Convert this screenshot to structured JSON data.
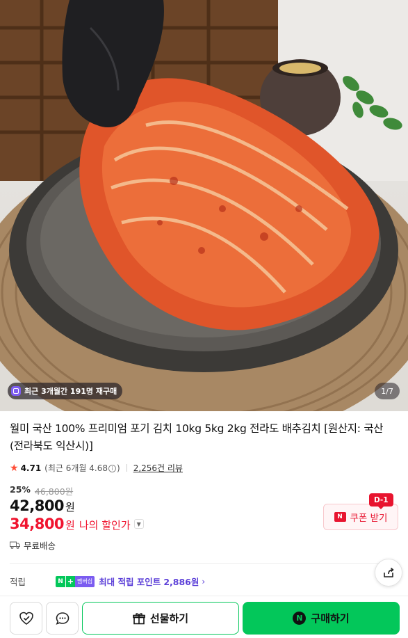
{
  "hero": {
    "rebuy_badge": "최근 3개월간 191명 재구매",
    "page_counter": "1/7"
  },
  "product": {
    "title": "월미 국산 100% 프리미엄 포기 김치 10kg 5kg 2kg 전라도 배추김치 [원산지: 국산(전라북도 익산시)]",
    "rating": "4.71",
    "recent_rating_prefix": "(최근 6개월 4.68",
    "recent_rating_suffix": ")",
    "review_count": "2,256건 리뷰"
  },
  "price": {
    "discount_rate": "25%",
    "original_price": "46,800원",
    "sale_price": "42,800",
    "sale_unit": "원",
    "member_price": "34,800",
    "member_unit": "원",
    "member_label": "나의 할인가"
  },
  "coupon": {
    "dday": "D-1",
    "label": "쿠폰 받기",
    "badge": "N"
  },
  "shipping": {
    "label": "무료배송"
  },
  "points": {
    "label": "적립",
    "npay_n": "N",
    "npay_plus": "+",
    "npay_member": "멤버십",
    "text": "최대 적립 포인트",
    "value": "2,886원"
  },
  "bottom_bar": {
    "gift_label": "선물하기",
    "buy_label": "구매하기",
    "buy_badge": "N"
  },
  "colors": {
    "accent_green": "#03c75a",
    "discount_red": "#f0142f",
    "points_purple": "#5b3fd8"
  }
}
